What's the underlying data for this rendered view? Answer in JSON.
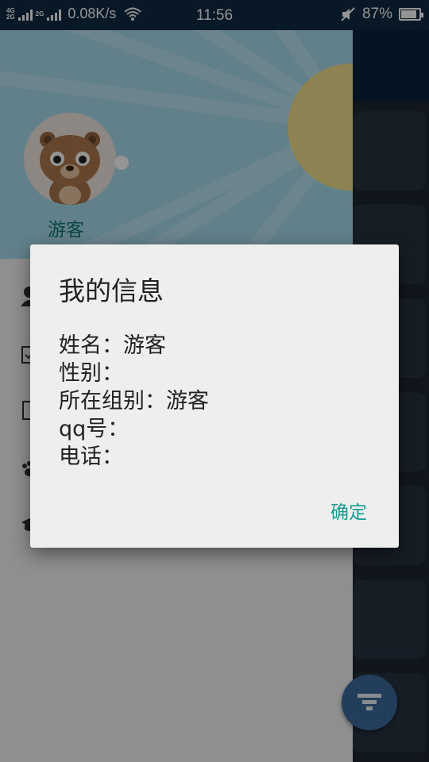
{
  "status_bar": {
    "network_tag_1": "4G",
    "network_tag_2": "2G",
    "network_tag_3": "2G",
    "speed": "0.08K/s",
    "time": "11:56",
    "battery": "87%",
    "battery_level": 0.87
  },
  "drawer": {
    "username": "游客"
  },
  "dialog": {
    "title": "我的信息",
    "fields": [
      "姓名：游客",
      "性别：",
      "所在组别：游客",
      "qq号：",
      "电话："
    ],
    "confirm_label": "确定"
  },
  "colors": {
    "accent": "#159e91",
    "header_bg": "#a9dcee",
    "fab": "#3d6b9c"
  }
}
